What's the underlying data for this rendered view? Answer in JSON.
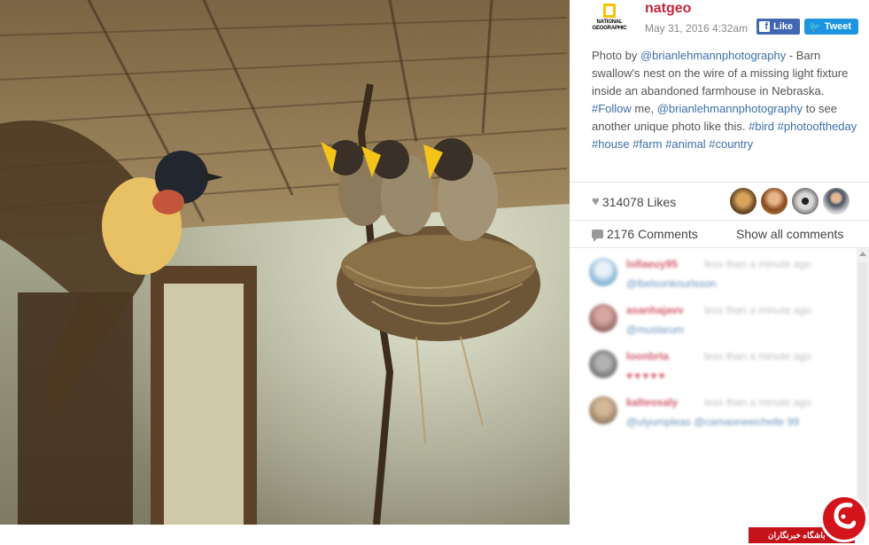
{
  "post": {
    "username": "natgeo",
    "date": "May 31, 2016 4:32am",
    "logo_text_line1": "NATIONAL",
    "logo_text_line2": "GEOGRAPHIC",
    "logo_color": "#f3c300",
    "fb_like_label": "Like",
    "fb_icon": "f",
    "tweet_label": "Tweet"
  },
  "caption": {
    "part1": "Photo by ",
    "mention1": "@brianlehmannphotography",
    "part2": " - Barn swallow's nest on the wire of a missing light fixture inside an abandoned farmhouse in Nebraska. ",
    "hashtag_follow": "#Follow",
    "part3": " me, ",
    "mention2": "@brianlehmannphotography",
    "part4": " to see another unique photo like this. ",
    "hashtag_bird": "#bird",
    "hashtag_photooftheday": "#photooftheday",
    "hashtag_house": "#house",
    "hashtag_farm": "#farm",
    "hashtag_animal": "#animal",
    "hashtag_country": "#country"
  },
  "stats": {
    "likes": "314078 Likes",
    "comments": "2176 Comments",
    "show_all": "Show all comments"
  },
  "comments": [
    {
      "user": "lollaeuy95",
      "time": "less than a minute ago",
      "text": "@lbelsonknurlsson"
    },
    {
      "user": "asanhajavv",
      "time": "less than a minute ago",
      "text": "@muslarum"
    },
    {
      "user": "loonbrta",
      "time": "less than a minute ago",
      "text": "♥♥♥♥♥",
      "hearts": true
    },
    {
      "user": "kalteosaly",
      "time": "less than a minute ago",
      "text": "@ulyumpleas @camaoneeichelle 99"
    }
  ],
  "watermark": {
    "text": "باشگاه خبرنگاران",
    "glyph": "ج",
    "color": "#d3151b"
  },
  "colors": {
    "username": "#c4253a",
    "link": "#3b6fa8",
    "facebook": "#4267b2",
    "twitter": "#1b95e0"
  }
}
